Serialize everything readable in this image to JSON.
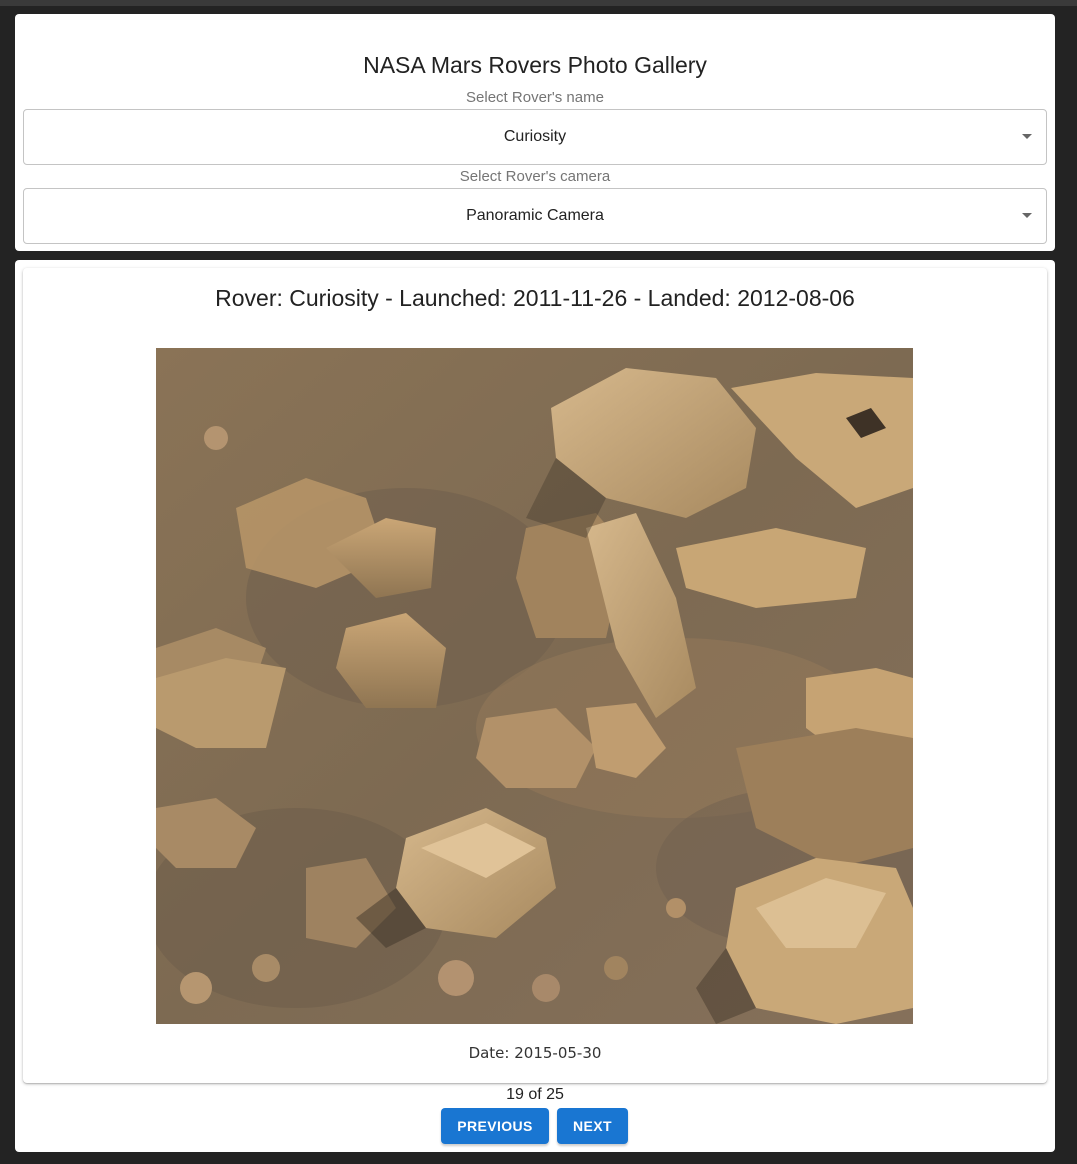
{
  "header": {
    "title": "NASA Mars Rovers Photo Gallery"
  },
  "rover_select": {
    "label": "Select Rover's name",
    "value": "Curiosity"
  },
  "camera_select": {
    "label": "Select Rover's camera",
    "value": "Panoramic Camera"
  },
  "photo_card": {
    "title": "Rover: Curiosity - Launched: 2011-11-26 - Landed: 2012-08-06",
    "date_text": "Date: 2015-05-30"
  },
  "pagination": {
    "counter": "19 of 25",
    "previous_label": "PREVIOUS",
    "next_label": "NEXT"
  },
  "colors": {
    "page_background": "#232323",
    "primary_button": "#1976d2",
    "martian_ground": "#8d7658",
    "rock_light": "#c9a878"
  }
}
